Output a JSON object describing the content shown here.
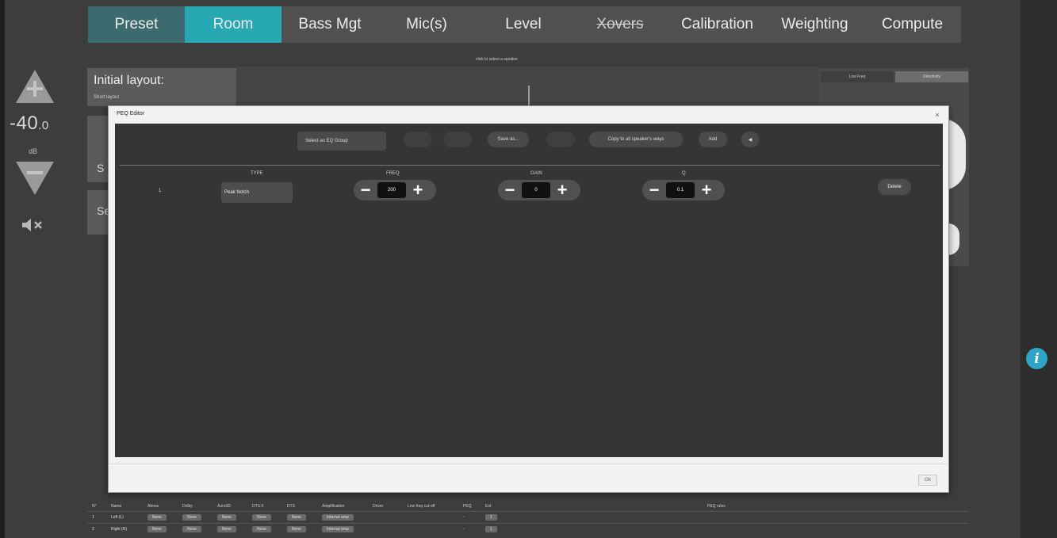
{
  "tabs": [
    {
      "label": "Preset"
    },
    {
      "label": "Room"
    },
    {
      "label": "Bass Mgt"
    },
    {
      "label": "Mic(s)"
    },
    {
      "label": "Level"
    },
    {
      "label": "Xovers"
    },
    {
      "label": "Calibration"
    },
    {
      "label": "Weighting"
    },
    {
      "label": "Compute"
    }
  ],
  "volume": {
    "value": "-40",
    "decimal": ".0",
    "unit": "dB"
  },
  "background": {
    "initial_layout_title": "Initial layout:",
    "initial_layout_sub": "Short layout",
    "speaker_hint": "click to select a speaker",
    "card1_label": "S",
    "card2_label": "Se",
    "right_tab1": "Low Freq",
    "right_tab2": "Directivity"
  },
  "bottom_table": {
    "headers": [
      "N°",
      "Name",
      "Atmos",
      "Dolby",
      "Auro3D",
      "DTS:X",
      "DTS",
      "Amplification",
      "Driver",
      "Low freq cut-off",
      "PEQ",
      "Ext",
      "",
      "",
      "",
      "PEQ rules"
    ],
    "rows": [
      [
        "1",
        "Left (L)",
        "None",
        "None",
        "None",
        "None",
        "None",
        "Internal amp",
        "",
        "",
        "◦",
        "1"
      ],
      [
        "2",
        "Right (R)",
        "None",
        "None",
        "None",
        "None",
        "None",
        "Internal amp",
        "",
        "",
        "◦",
        "1"
      ]
    ]
  },
  "dialog": {
    "title": "PEQ Editor",
    "close": "×",
    "ok": "Ok",
    "toolbar": {
      "eq_group_select": "Select an EQ Group",
      "save_as": "Save as...",
      "copy_to_all": "Copy to all speaker's ways",
      "add": "Add",
      "speaker_icon": "◀"
    },
    "columns": {
      "type": "TYPE",
      "freq": "FREQ",
      "gain": "GAIN",
      "q": "Q"
    },
    "filters": [
      {
        "index": "1",
        "type": "Peak Notch",
        "freq": "200",
        "gain": "0",
        "q": "0.1",
        "delete": "Delete"
      }
    ]
  }
}
